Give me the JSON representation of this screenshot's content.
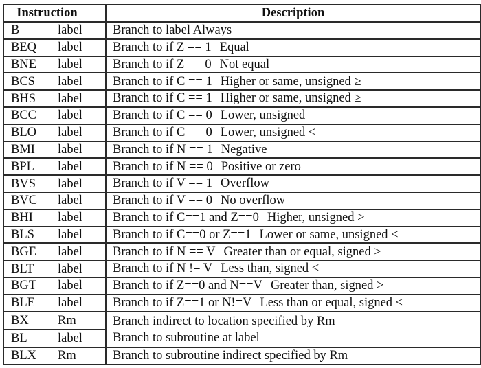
{
  "table": {
    "headers": {
      "instruction": "Instruction",
      "description": "Description"
    },
    "rows": [
      {
        "mnemonic": "B",
        "operand": "label",
        "description": "Branch to label Always"
      },
      {
        "mnemonic": "BEQ",
        "operand": "label",
        "condition": "Branch to if Z == 1",
        "meaning": "Equal"
      },
      {
        "mnemonic": "BNE",
        "operand": "label",
        "condition": "Branch to if Z == 0",
        "meaning": "Not equal"
      },
      {
        "mnemonic": "BCS",
        "operand": "label",
        "condition": "Branch to if C == 1",
        "meaning": "Higher or same, unsigned ≥"
      },
      {
        "mnemonic": "BHS",
        "operand": "label",
        "condition": "Branch to if C == 1",
        "meaning": "Higher or same, unsigned ≥"
      },
      {
        "mnemonic": "BCC",
        "operand": "label",
        "condition": "Branch to if C == 0",
        "meaning": "Lower, unsigned"
      },
      {
        "mnemonic": "BLO",
        "operand": "label",
        "condition": "Branch to if C == 0",
        "meaning": "Lower, unsigned <"
      },
      {
        "mnemonic": "BMI",
        "operand": "label",
        "condition": "Branch to if N == 1",
        "meaning": "Negative"
      },
      {
        "mnemonic": "BPL",
        "operand": "label",
        "condition": "Branch to if N == 0",
        "meaning": "Positive or zero"
      },
      {
        "mnemonic": "BVS",
        "operand": "label",
        "condition": "Branch to if V == 1",
        "meaning": "Overflow"
      },
      {
        "mnemonic": "BVC",
        "operand": "label",
        "condition": "Branch to if V == 0",
        "meaning": "No overflow"
      },
      {
        "mnemonic": "BHI",
        "operand": "label",
        "condition": "Branch to if C==1 and Z==0",
        "meaning": "Higher, unsigned >"
      },
      {
        "mnemonic": "BLS",
        "operand": "label",
        "condition": "Branch to if C==0 or  Z==1",
        "meaning": "Lower or same, unsigned ≤"
      },
      {
        "mnemonic": "BGE",
        "operand": "label",
        "condition": "Branch to if N == V",
        "meaning": "Greater than or equal, signed ≥"
      },
      {
        "mnemonic": "BLT",
        "operand": "label",
        "condition": "Branch to if N != V",
        "meaning": "Less than, signed <"
      },
      {
        "mnemonic": "BGT",
        "operand": "label",
        "condition": "Branch to if Z==0 and N==V",
        "meaning": "Greater than, signed >"
      },
      {
        "mnemonic": "BLE",
        "operand": "label",
        "condition": "Branch to if Z==1 or N!=V",
        "meaning": "Less than or equal, signed ≤"
      },
      {
        "mnemonic": "BX",
        "operand": "Rm",
        "description": "Branch indirect to location specified by Rm"
      },
      {
        "mnemonic": "BL",
        "operand": "label",
        "description": "Branch to subroutine at label"
      },
      {
        "mnemonic": "BLX",
        "operand": "Rm",
        "description": "Branch to subroutine indirect specified by Rm"
      }
    ]
  }
}
